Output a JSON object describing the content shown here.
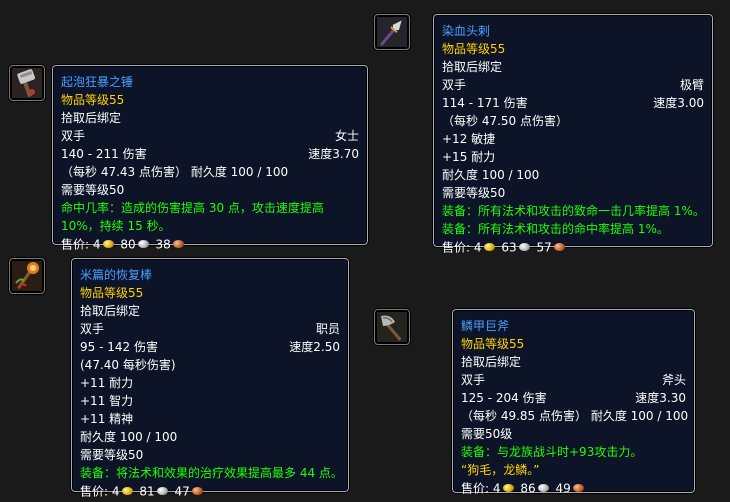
{
  "items": [
    {
      "name": "起泡狂暴之锤",
      "icon": "mace-icon",
      "item_level": "物品等级55",
      "bind": "拾取后绑定",
      "slot": "双手",
      "type": "女士",
      "damage": "140 - 211 伤害",
      "speed": "速度3.70",
      "dps": "（每秒 47.43 点伤害）",
      "durability": "耐久度 100 / 100",
      "stats": [],
      "required_level": "需要等级50",
      "effects": [
        "命中几率：造成的伤害提高 30 点，攻击速度提高 10%，持续 15 秒。"
      ],
      "sell_label": "售价:",
      "gold": "4",
      "silver": "80",
      "copper": "38"
    },
    {
      "name": "染血头剌",
      "icon": "spear-icon",
      "item_level": "物品等级55",
      "bind": "拾取后绑定",
      "slot": "双手",
      "type": "极臂",
      "damage": "114 - 171 伤害",
      "speed": "速度3.00",
      "dps": "（每秒 47.50 点伤害）",
      "durability": "耐久度 100 / 100",
      "stats": [
        "+12 敏捷",
        "+15 耐力"
      ],
      "required_level": "需要等级50",
      "effects": [
        "装备：所有法术和攻击的致命一击几率提高 1%。",
        "装备：所有法术和攻击的命中率提高 1%。"
      ],
      "sell_label": "售价:",
      "gold": "4",
      "silver": "63",
      "copper": "57"
    },
    {
      "name": "米篇的恢复棒",
      "icon": "staff-icon",
      "item_level": "物品等级55",
      "bind": "拾取后绑定",
      "slot": "双手",
      "type": "职员",
      "damage": "95 - 142 伤害",
      "speed": "速度2.50",
      "dps": "(47.40 每秒伤害)",
      "durability": "耐久度 100 / 100",
      "stats": [
        "+11 耐力",
        "+11 智力",
        "+11 精神"
      ],
      "required_level": "需要等级50",
      "effects": [
        "装备：将法术和效果的治疗效果提高最多 44 点。"
      ],
      "sell_label": "售价:",
      "gold": "4",
      "silver": "81",
      "copper": "47"
    },
    {
      "name": "鳞甲巨斧",
      "icon": "axe-icon",
      "item_level": "物品等级55",
      "bind": "拾取后绑定",
      "slot": "双手",
      "type": "斧头",
      "damage": "125 - 204 伤害",
      "speed": "速度3.30",
      "dps": "（每秒 49.85 点伤害）",
      "durability": "耐久度 100 / 100",
      "stats": [],
      "required_level": "需要50级",
      "effects": [
        "装备：与龙族战斗时+93攻击力。"
      ],
      "flavor": "“狗毛，龙鳞。”",
      "sell_label": "售价:",
      "gold": "4",
      "silver": "86",
      "copper": "49"
    }
  ],
  "colors": {
    "name": "#4a9eff",
    "item_level": "#ffd100",
    "effect": "#1eff00",
    "tooltip_bg": "#0d1428",
    "border": "#a7adb6"
  }
}
